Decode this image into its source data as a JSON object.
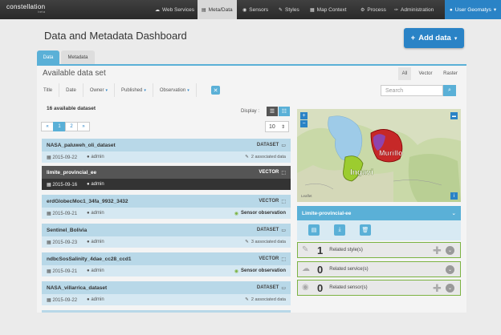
{
  "logo": {
    "name": "constellation",
    "sub": "beta"
  },
  "nav": {
    "items": [
      {
        "label": "Web Services",
        "icon": "cloud-icon"
      },
      {
        "label": "Meta/Data",
        "icon": "file-icon"
      },
      {
        "label": "Sensors",
        "icon": "sensor-icon"
      },
      {
        "label": "Styles",
        "icon": "brush-icon"
      },
      {
        "label": "Map Context",
        "icon": "map-icon"
      },
      {
        "label": "Process",
        "icon": "gear-icon"
      },
      {
        "label": "Administration",
        "icon": "wrench-icon"
      }
    ],
    "user": "User Geomatys"
  },
  "page": {
    "title": "Data and Metadata Dashboard",
    "add_button": "Add data"
  },
  "tabs": [
    "Data",
    "Metadata"
  ],
  "panel": {
    "title": "Available data set",
    "type_filters": [
      "All",
      "Vector",
      "Raster"
    ],
    "filters": [
      "Title",
      "Date",
      "Owner",
      "Published",
      "Observation"
    ],
    "search_placeholder": "Search",
    "count_text": "16 available dataset",
    "display_label": "Display :",
    "pages": [
      "«",
      "1",
      "2",
      "»"
    ],
    "per_page": "10"
  },
  "rows": [
    {
      "title": "NASA_paluweh_oli_dataset",
      "type": "DATASET",
      "date": "2015-09-22",
      "owner": "admin",
      "info": "2 associated data"
    },
    {
      "title": "limite_provincial_ee",
      "type": "VECTOR",
      "date": "2015-09-16",
      "owner": "admin",
      "info": ""
    },
    {
      "title": "erdGlobecMoc1_34fa_9932_3432",
      "type": "VECTOR",
      "date": "2015-09-21",
      "owner": "admin",
      "info": "Sensor observation"
    },
    {
      "title": "Sentinel_Bolivia",
      "type": "DATASET",
      "date": "2015-09-23",
      "owner": "admin",
      "info": "3 associated data"
    },
    {
      "title": "ndbcSosSalinity_4dae_cc28_ccd1",
      "type": "VECTOR",
      "date": "2015-09-21",
      "owner": "admin",
      "info": "Sensor observation"
    },
    {
      "title": "NASA_villarrica_dataset",
      "type": "DATASET",
      "date": "2015-09-22",
      "owner": "admin",
      "info": "2 associated data"
    }
  ],
  "map": {
    "labels": [
      "Murillo",
      "Ingavi"
    ],
    "credit": "Leaflet"
  },
  "detail": {
    "title": "Limite-provincial-ee",
    "related": [
      {
        "count": "1",
        "label": "Related style(s)"
      },
      {
        "count": "0",
        "label": "Related service(s)"
      },
      {
        "count": "0",
        "label": "Related sensor(s)"
      }
    ]
  },
  "colors": {
    "accent": "#2a83c6",
    "light_accent": "#5ab0d7",
    "topbar": "#333333",
    "murillo": "#c62828",
    "ingavi": "#9ccc2f"
  }
}
